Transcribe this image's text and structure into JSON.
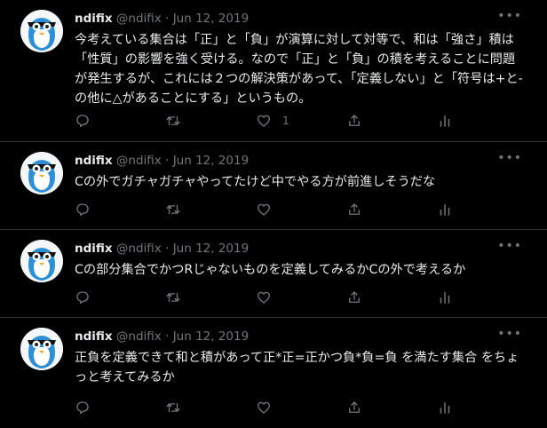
{
  "colors": {
    "background": "#000000",
    "text": "#e7e9ea",
    "muted": "#71767b",
    "divider": "#2f3336"
  },
  "icons": [
    "more-icon",
    "reply-icon",
    "retweet-icon",
    "like-icon",
    "share-icon",
    "analytics-icon"
  ],
  "tweets": [
    {
      "name": "ndifix",
      "handle": "@ndifix",
      "date": "Jun 12, 2019",
      "more": "•••",
      "text": "今考えている集合は「正」と「負」が演算に対して対等で、和は「強さ」積は「性質」の影響を強く受ける。なので「正」と「負」の積を考えることに問題が発生するが、これには２つの解決策があって、「定義しない」と「符号は+と-の他に△があることにする」というもの。",
      "like_count": "1"
    },
    {
      "name": "ndifix",
      "handle": "@ndifix",
      "date": "Jun 12, 2019",
      "more": "•••",
      "text": "Cの外でガチャガチャやってたけど中でやる方が前進しそうだな",
      "like_count": ""
    },
    {
      "name": "ndifix",
      "handle": "@ndifix",
      "date": "Jun 12, 2019",
      "more": "•••",
      "text": "Cの部分集合でかつRじゃないものを定義してみるかCの外で考えるか",
      "like_count": ""
    },
    {
      "name": "ndifix",
      "handle": "@ndifix",
      "date": "Jun 12, 2019",
      "more": "•••",
      "text": "正負を定義できて和と積があって正*正=正かつ負*負=負 を満たす集合 をちょっと考えてみるか",
      "like_count": ""
    }
  ]
}
